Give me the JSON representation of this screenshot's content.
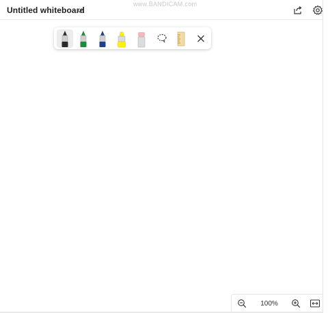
{
  "header": {
    "title": "Untitled whiteboard",
    "watermark": "www.BANDICAM.com",
    "icons": {
      "chevron": "chevron-down-icon",
      "share": "share-icon",
      "settings": "gear-icon"
    }
  },
  "toolbar": {
    "tools": [
      {
        "name": "black-pen",
        "color": "#2b2b2b",
        "selected": true
      },
      {
        "name": "green-pen",
        "color": "#1e8a3a",
        "selected": false
      },
      {
        "name": "blue-pen",
        "color": "#1f3f8a",
        "selected": false
      },
      {
        "name": "highlighter",
        "color": "#fff200",
        "selected": false
      },
      {
        "name": "eraser",
        "color": "#f5b6c0",
        "selected": false
      },
      {
        "name": "lasso",
        "icon": "lasso-icon",
        "selected": false
      },
      {
        "name": "ruler",
        "icon": "ruler-icon",
        "selected": false
      },
      {
        "name": "close",
        "icon": "close-icon",
        "selected": false
      }
    ]
  },
  "zoom": {
    "level": "100%"
  },
  "colors": {
    "canvas": "#ffffff",
    "toolbar_shadow": "#c8c8c8",
    "text": "#202020"
  }
}
